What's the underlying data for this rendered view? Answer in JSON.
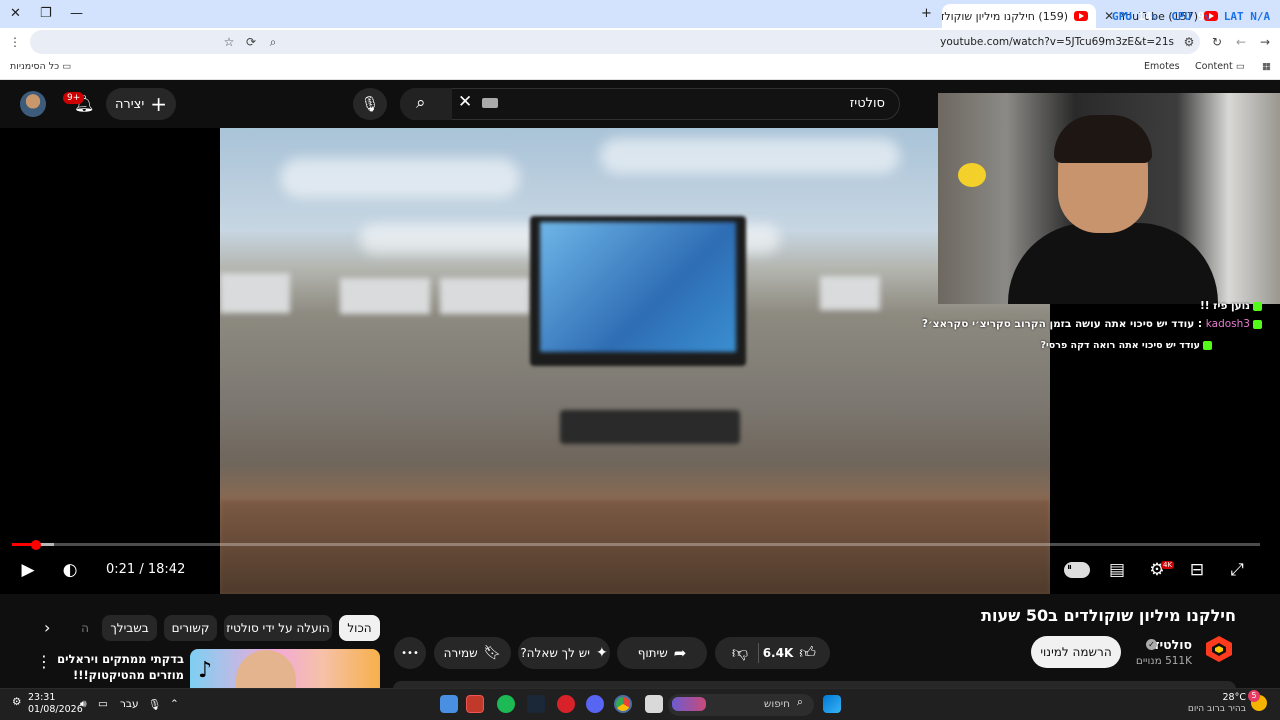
{
  "browser": {
    "tabs": [
      {
        "title": "(159) חילקנו מיליון שוקולדים ב50 שעות - YouTube",
        "active": true
      },
      {
        "title": "(157) YouTube",
        "active": false
      }
    ],
    "hud": {
      "gpu_label": "GPU",
      "gpu_value": "14",
      "cpu_label": "CPU",
      "cpu_value": "9",
      "lat_label": "LAT",
      "lat_value": "N/A",
      "pct": "%"
    },
    "url": "youtube.com/watch?v=5JTcu69m3zE&t=21s",
    "bookmarks": {
      "all_bookmarks": "כל הסימניות",
      "emotes": "Emotes",
      "content": "Content"
    }
  },
  "header": {
    "create_label": "יצירה",
    "notifications_badge": "9+",
    "search_value": "סולטיז"
  },
  "player": {
    "current_time": "0:21",
    "duration": "18:42",
    "time_separator": "/",
    "progress_played_fraction": 0.019,
    "hd_badge": "4K"
  },
  "chat": [
    {
      "user": "",
      "message": "נוען פיז !!"
    },
    {
      "user": "kadosh3",
      "message": "עודד יש סיכוי אתה עושה בזמן הקרוב סקריצ׳י סקראצ׳?"
    },
    {
      "user": "",
      "message": "עודד יש סיכוי אתה רואה דקה פרסי?"
    }
  ],
  "video": {
    "title": "חילקנו מיליון שוקולדים ב50 שעות",
    "channel_name": "סולטיז",
    "subscribers": "511K מנויים",
    "subscribe_label": "הרשמה למינוי",
    "likes": "6.4K",
    "share_label": "שיתוף",
    "ask_label": "יש לך שאלה?",
    "save_label": "שמירה",
    "more_label": "•••"
  },
  "chips": [
    {
      "label": "הכול",
      "active": true
    },
    {
      "label": "הועלה על ידי סולטיז",
      "active": false
    },
    {
      "label": "קשורים",
      "active": false
    },
    {
      "label": "בשבילך",
      "active": false
    },
    {
      "label": "ה",
      "active": false
    }
  ],
  "recommendation": {
    "title": "בדקתי ממתקים ויראלים מוזרים מהטיקטוק!!!"
  },
  "taskbar": {
    "search_label": "חיפוש",
    "time": "23:31",
    "date": "01/08/2026",
    "language": "עבר",
    "weather_temp": "28°C",
    "weather_desc": "בהיר ברוב היום",
    "weather_badge": "5"
  }
}
